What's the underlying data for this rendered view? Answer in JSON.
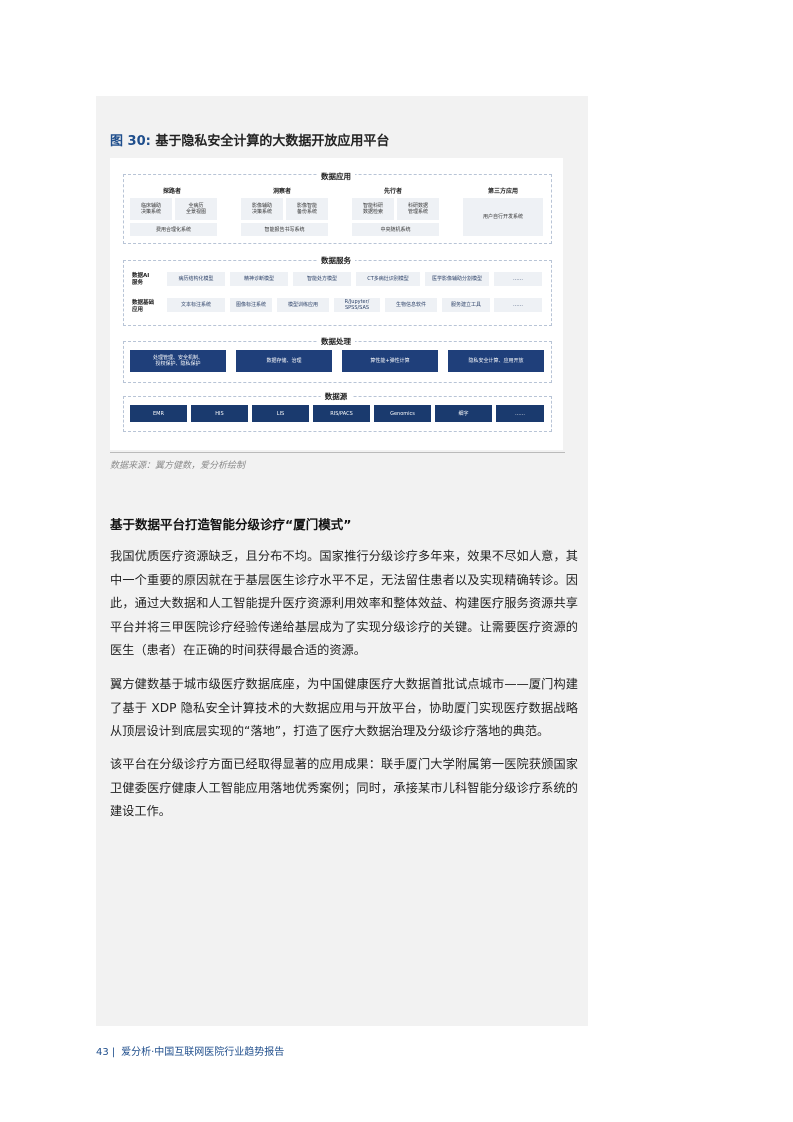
{
  "figure": {
    "number": "图 30:",
    "title": "基于隐私安全计算的大数据开放应用平台",
    "source": "数据来源：翼方健数，爱分析绘制"
  },
  "diagram": {
    "app": {
      "title": "数据应用",
      "columns": [
        {
          "name": "探路者",
          "cells": [
            "临床辅助\n决策系统",
            "全病历\n全景视图"
          ],
          "bottom": "费用合理化系统"
        },
        {
          "name": "洞察者",
          "cells": [
            "影像辅助\n决策系统",
            "影像智能\n备份系统"
          ],
          "bottom": "智能报告书写系统"
        },
        {
          "name": "先行者",
          "cells": [
            "智能科研\n数据检索",
            "科研数据\n管理系统"
          ],
          "bottom": "中央随机系统"
        },
        {
          "name": "第三方应用",
          "cells": [],
          "bottom": "用户自行开发系统"
        }
      ]
    },
    "service": {
      "title": "数据服务",
      "rows": [
        {
          "label": "数据AI\n服务",
          "items": [
            "病历结构化模型",
            "精神诊断模型",
            "智能处方模型",
            "CT多病灶识别模型",
            "医学影像辅助分割模型",
            "……"
          ]
        },
        {
          "label": "数据基础\n应用",
          "items": [
            "文本标注系统",
            "图像标注系统",
            "模型训练应用",
            "R/Jupyter/\nSPSS/SAS",
            "生物信息软件",
            "服务建立工具",
            "……"
          ]
        }
      ]
    },
    "processing": {
      "title": "数据处理",
      "items": [
        "处理管理、安全机制、\n授权保护、隐私保护",
        "数据存储、治理",
        "算性能+弹性计算",
        "隐私安全计算、应用开放"
      ]
    },
    "source": {
      "title": "数据源",
      "items": [
        "EMR",
        "HIS",
        "LIS",
        "RIS/PACS",
        "Genomics",
        "细字",
        "……"
      ]
    }
  },
  "heading": "基于数据平台打造智能分级诊疗“厦门模式”",
  "paragraphs": [
    "我国优质医疗资源缺乏，且分布不均。国家推行分级诊疗多年来，效果不尽如人意，其中一个重要的原因就在于基层医生诊疗水平不足，无法留住患者以及实现精确转诊。因此，通过大数据和人工智能提升医疗资源利用效率和整体效益、构建医疗服务资源共享平台并将三甲医院诊疗经验传递给基层成为了实现分级诊疗的关键。让需要医疗资源的医生（患者）在正确的时间获得最合适的资源。",
    "翼方健数基于城市级医疗数据底座，为中国健康医疗大数据首批试点城市——厦门构建了基于 XDP 隐私安全计算技术的大数据应用与开放平台，协助厦门实现医疗数据战略从顶层设计到底层实现的“落地”，打造了医疗大数据治理及分级诊疗落地的典范。",
    "该平台在分级诊疗方面已经取得显著的应用成果：联手厦门大学附属第一医院获颁国家卫健委医疗健康人工智能应用落地优秀案例；同时，承接某市儿科智能分级诊疗系统的建设工作。"
  ],
  "footer": {
    "page": "43",
    "text": "爱分析·中国互联网医院行业趋势报告"
  }
}
